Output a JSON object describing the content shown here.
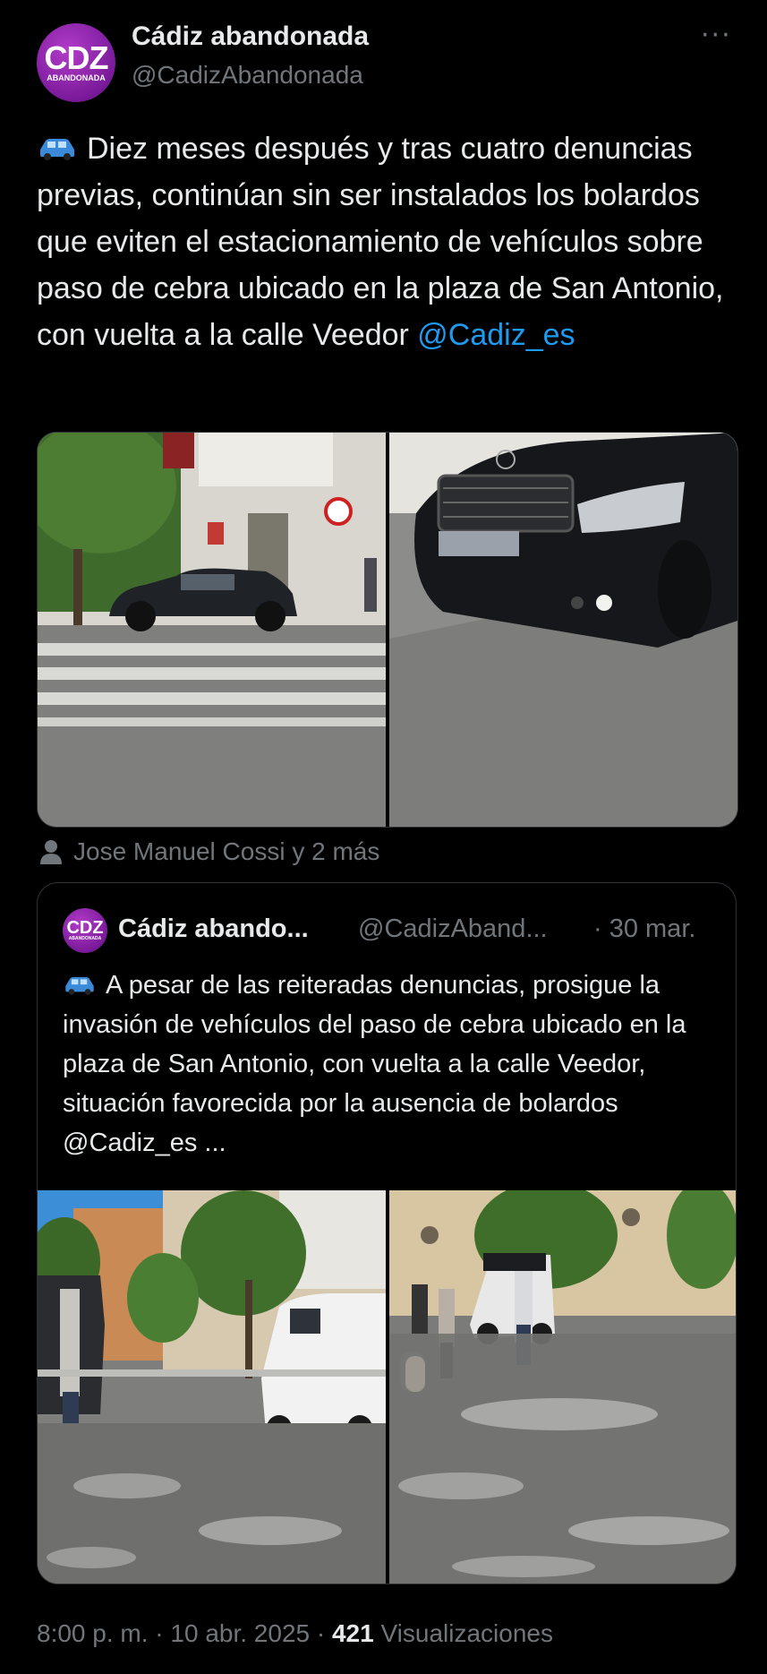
{
  "header": {
    "avatar_big": "CDZ",
    "avatar_small": "ABANDONADA",
    "display_name": "Cádiz abandonada",
    "handle": "@CadizAbandonada",
    "more_label": "···"
  },
  "tweet": {
    "text": "Diez meses después y tras cuatro denuncias previas, continúan sin ser instalados los bolardos que eviten el estacionamiento de vehículos sobre paso de cebra ubicado en la plaza de San Antonio, con vuelta a la calle Veedor",
    "mention": "@Cadiz_es",
    "tagged": "Jose Manuel Cossi y 2 más"
  },
  "quote": {
    "avatar_big": "CDZ",
    "avatar_small": "ABANDONADA",
    "display_name": "Cádiz abando...",
    "handle": "@CadizAband...",
    "date": "· 30 mar.",
    "text": "A pesar de las reiteradas denuncias, prosigue la invasión de vehículos del paso de cebra ubicado en la plaza de San Antonio, con vuelta a la calle Veedor, situación favorecida por la ausencia de bolardos",
    "mention": "@Cadiz_es",
    "ellipsis": " ..."
  },
  "footer": {
    "time": "8:00 p. m. · 10 abr. 2025 · ",
    "views_count": "421",
    "views_label": " Visualizaciones"
  },
  "colors": {
    "background": "#000000",
    "text": "#e7e9ea",
    "muted": "#71767b",
    "link": "#1d9bf0",
    "border": "#2f3336",
    "brand_purple": "#8a1fa8"
  }
}
